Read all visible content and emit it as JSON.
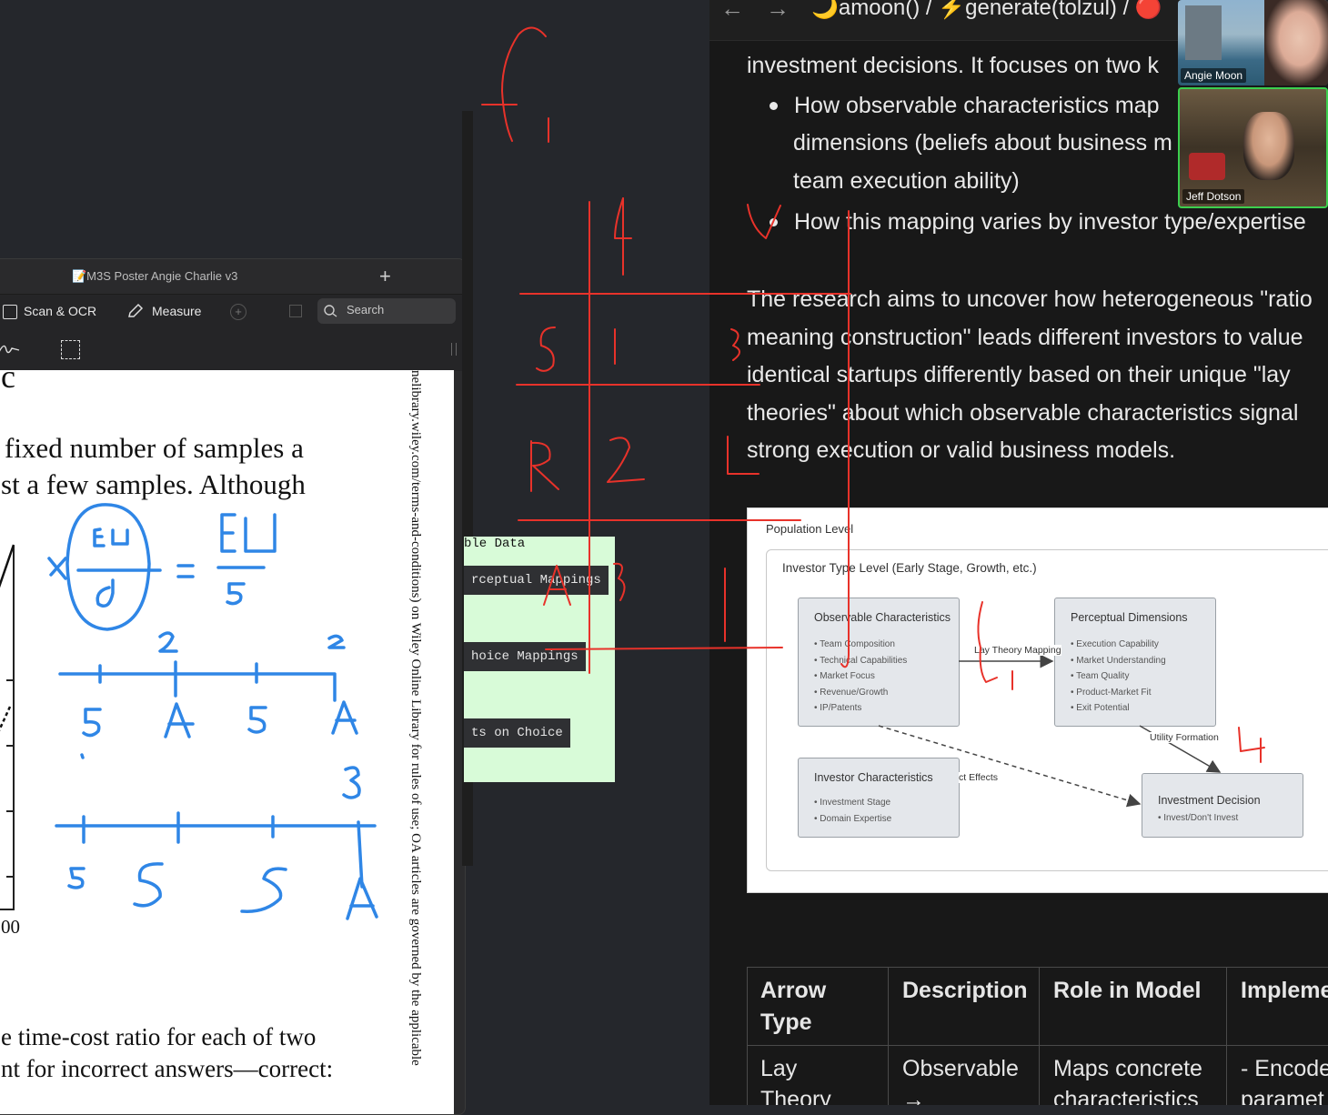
{
  "browser": {
    "nav_back": "←",
    "nav_forward": "→",
    "breadcrumb": "🌙amoon() / ⚡generate(tolzul) / 🔴",
    "doc": {
      "line1": "investment decisions. It focuses on two k",
      "bullets": [
        "How observable characteristics map",
        "dimensions (beliefs about business m",
        "team execution ability)",
        "How this mapping varies by investor type/expertise"
      ],
      "para": [
        "The research aims to uncover how heterogeneous \"ratio",
        "meaning construction\" leads different investors to value",
        "identical startups differently based on their unique \"lay",
        "theories\" about which observable characteristics signal",
        "strong execution or valid business models."
      ]
    },
    "diagram": {
      "population_label": "Population Level",
      "investor_type_label": "Investor Type Level (Early Stage, Growth, etc.)",
      "observable": {
        "title": "Observable Characteristics",
        "items": [
          "• Team Composition",
          "• Technical Capabilities",
          "• Market Focus",
          "• Revenue/Growth",
          "• IP/Patents"
        ]
      },
      "perceptual": {
        "title": "Perceptual Dimensions",
        "items": [
          "• Execution Capability",
          "• Market Understanding",
          "• Team Quality",
          "• Product-Market Fit",
          "• Exit Potential"
        ]
      },
      "investor_chars": {
        "title": "Investor Characteristics",
        "items": [
          "• Investment Stage",
          "• Domain Expertise"
        ]
      },
      "decision": {
        "title": "Investment Decision",
        "items": [
          "• Invest/Don't Invest"
        ]
      },
      "lay_theory_label": "Lay Theory Mapping",
      "utility_label": "Utility Formation",
      "effects_label": "ct Effects"
    },
    "table": {
      "headers": [
        "Arrow Type",
        "Description",
        "Role in Model",
        "Impleme"
      ],
      "header_line1": [
        "Arrow",
        "Description",
        "Role in Model",
        "Impleme"
      ],
      "header_line2": [
        "Type",
        "",
        "",
        ""
      ],
      "row1_line1": [
        "Lay",
        "Observable",
        "Maps concrete",
        "- Encode"
      ],
      "row1_line2": [
        "Theory",
        "→",
        "characteristics",
        "paramet"
      ]
    }
  },
  "video": {
    "participant1": "Angie Moon",
    "participant2": "Jeff Dotson"
  },
  "pdf": {
    "title": "📝M3S Poster Angie Charlie v3",
    "add_tab": "+",
    "toolbar": {
      "scan_ocr": "Scan & OCR",
      "measure": "Measure",
      "search_placeholder": "Search"
    },
    "page": {
      "heading_fragment": "c",
      "line1": "fixed number of samples a",
      "line2": "st a few samples. Although",
      "axis_tick": "00",
      "line3": "e time-cost ratio for each of two",
      "line4": "nt for incorrect answers—correct:",
      "side_note": "nelibrary.wiley.com/terms-and-conditions) on Wiley Online Library for rules of use; OA articles are governed by the applicable"
    }
  },
  "green_panel": {
    "title": "ble Data",
    "btn1": "rceptual Mappings",
    "btn2": "hoice Mappings",
    "btn3": "ts on Choice"
  },
  "colors": {
    "red_ink": "#e8322a",
    "blue_ink": "#2f86e6",
    "green_panel": "#d8fbd8"
  }
}
